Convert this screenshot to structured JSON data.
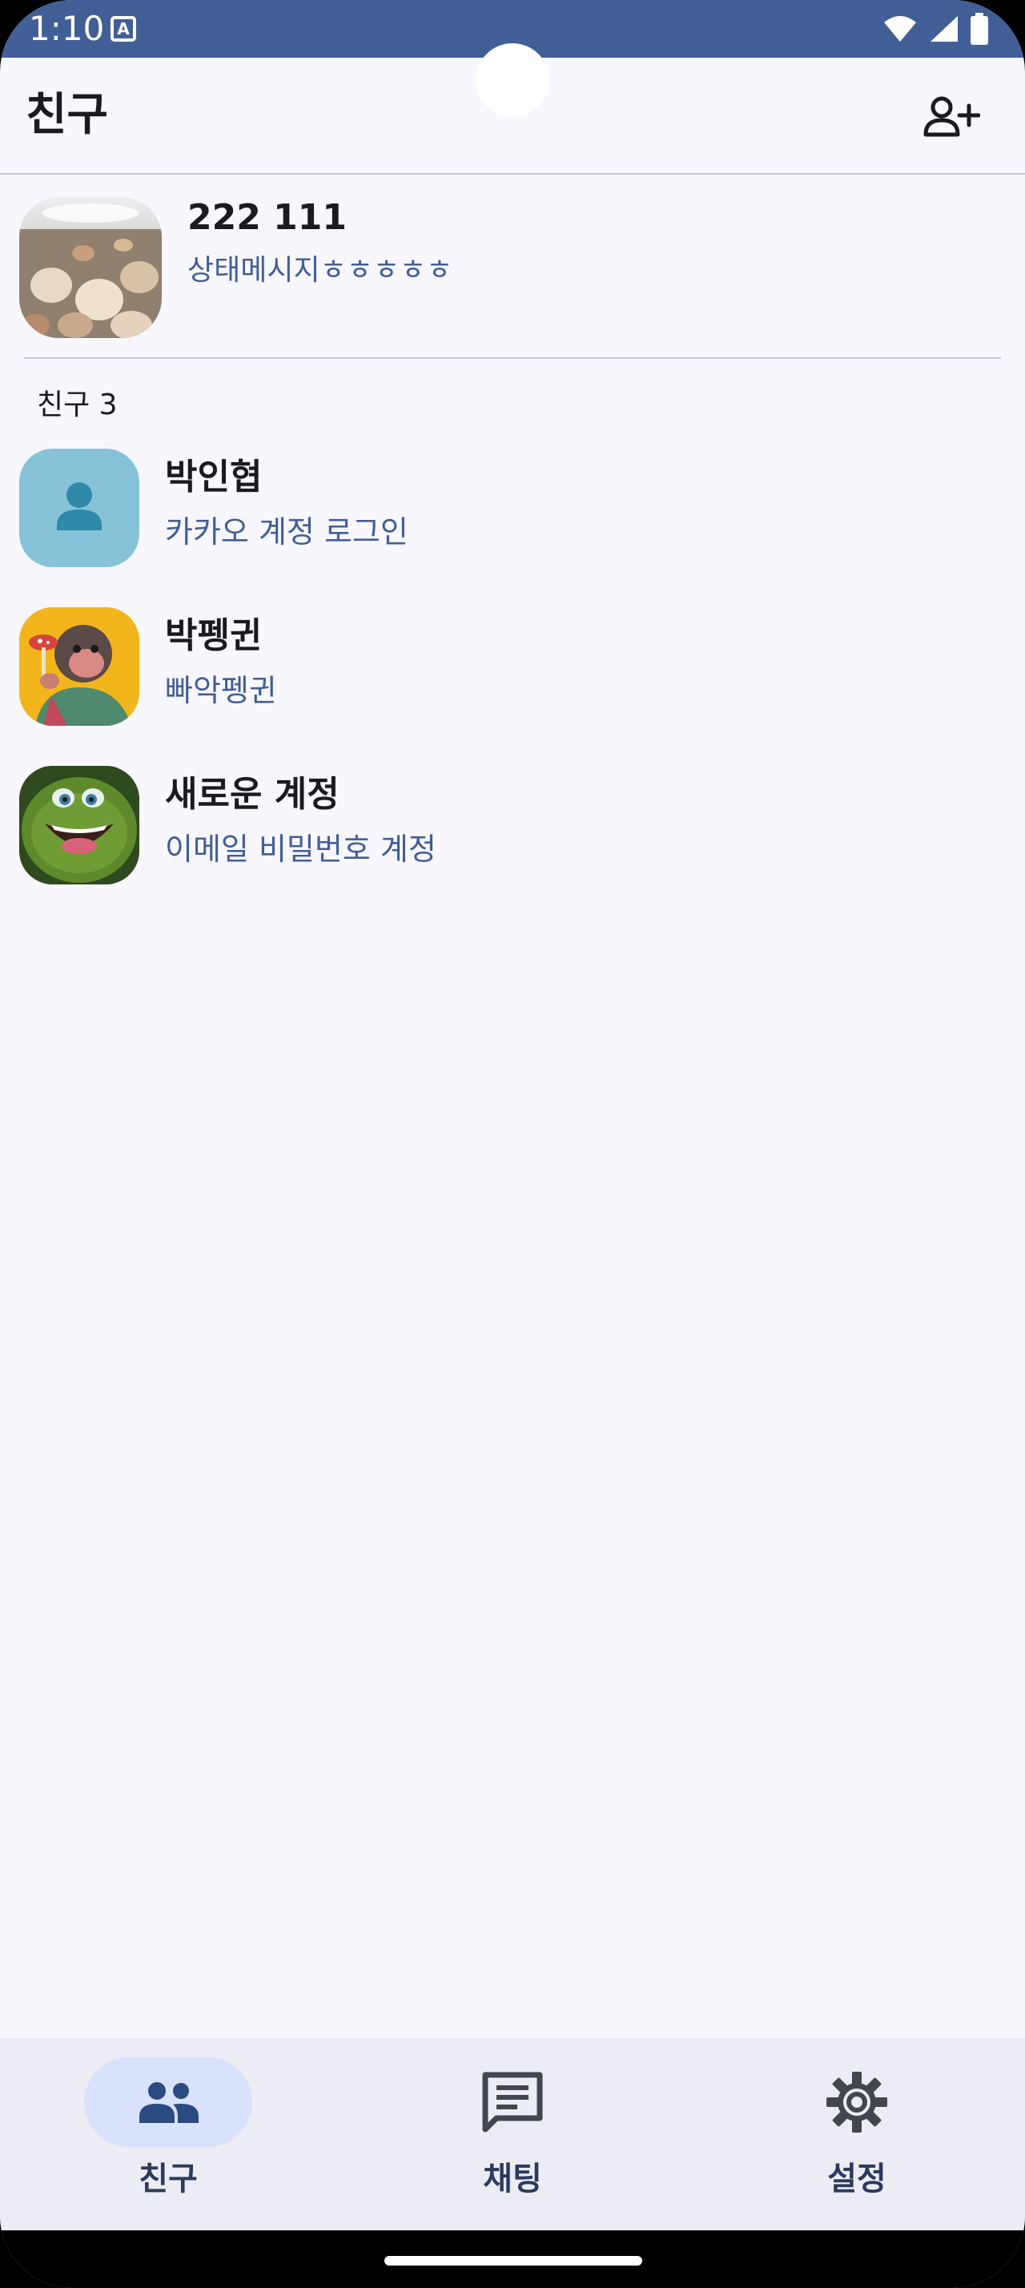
{
  "status_bar": {
    "time": "1:10",
    "icons": [
      "keyboard-a-icon",
      "wifi-icon",
      "signal-icon",
      "battery-icon"
    ],
    "color": "#415f96"
  },
  "app_bar": {
    "title": "친구",
    "add_friend_icon": "person-add-icon"
  },
  "my_profile": {
    "name": "222 111",
    "status_message": "상태메시지ㅎㅎㅎㅎㅎ",
    "avatar": "seashells-photo"
  },
  "friends_section": {
    "label": "친구 3",
    "items": [
      {
        "name": "박인협",
        "status": "카카오 계정 로그인",
        "avatar": "default-person-avatar"
      },
      {
        "name": "박펭귄",
        "status": "빠악펭귄",
        "avatar": "monkey-illustration"
      },
      {
        "name": "새로운 계정",
        "status": "이메일 비밀번호 계정",
        "avatar": "green-frog-illustration"
      }
    ]
  },
  "bottom_nav": {
    "items": [
      {
        "label": "친구",
        "icon": "people-icon",
        "active": true
      },
      {
        "label": "채팅",
        "icon": "chat-icon",
        "active": false
      },
      {
        "label": "설정",
        "icon": "settings-gear-icon",
        "active": false
      }
    ]
  },
  "colors": {
    "accent": "#415f96",
    "background": "#f8f7fe",
    "nav_background": "#ecedf4",
    "nav_active_pill": "#d8e2fa"
  }
}
